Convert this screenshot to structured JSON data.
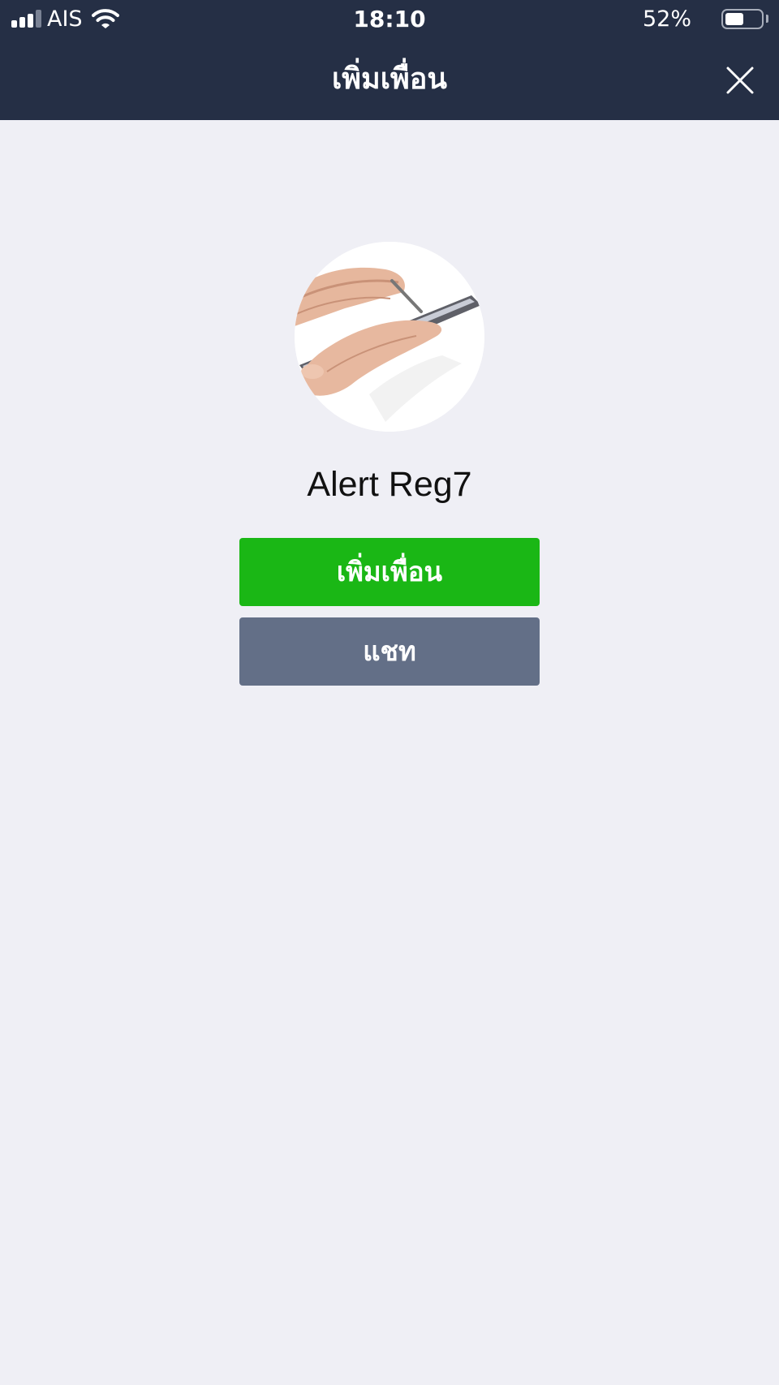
{
  "status_bar": {
    "carrier": "AIS",
    "time": "18:10",
    "battery_percent_label": "52%",
    "battery_level": 0.52,
    "signal_bars_active": 3,
    "signal_bars_total": 4
  },
  "header": {
    "title": "เพิ่มเพื่อน",
    "close_icon": "close-icon"
  },
  "profile": {
    "avatar_icon": "hand-with-tablet-image",
    "name": "Alert Reg7"
  },
  "actions": {
    "add_friend_label": "เพิ่มเพื่อน",
    "chat_label": "แชท"
  },
  "colors": {
    "header_bg": "#252f45",
    "page_bg": "#efeff5",
    "add_friend_button": "#1ab715",
    "chat_button": "#636f87"
  }
}
